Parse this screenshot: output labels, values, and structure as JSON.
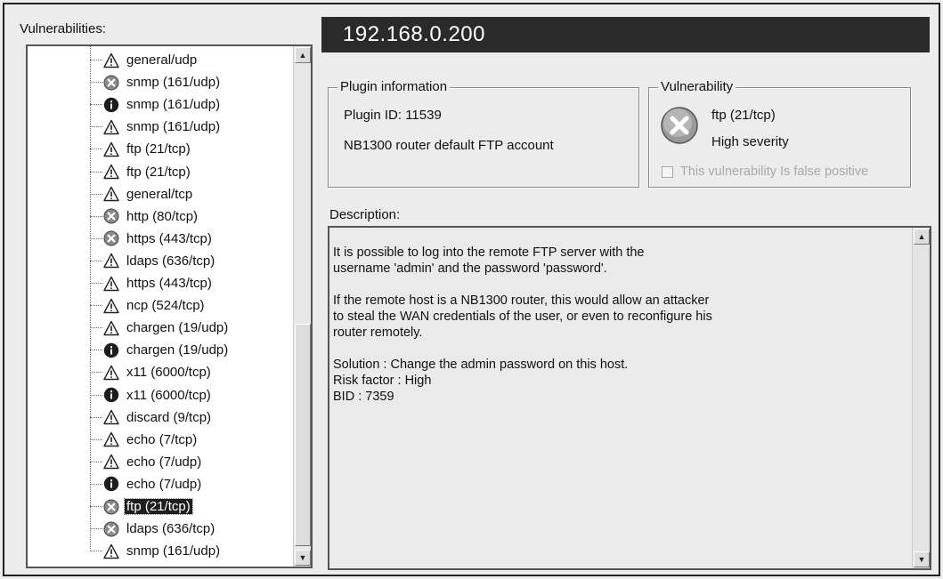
{
  "tree": {
    "label": "Vulnerabilities:",
    "items": [
      {
        "icon": "warning",
        "label": "general/udp"
      },
      {
        "icon": "high",
        "label": "snmp (161/udp)"
      },
      {
        "icon": "info",
        "label": "snmp (161/udp)"
      },
      {
        "icon": "warning",
        "label": "snmp (161/udp)"
      },
      {
        "icon": "warning",
        "label": "ftp (21/tcp)"
      },
      {
        "icon": "warning",
        "label": "ftp (21/tcp)"
      },
      {
        "icon": "warning",
        "label": "general/tcp"
      },
      {
        "icon": "high",
        "label": "http (80/tcp)"
      },
      {
        "icon": "high",
        "label": "https (443/tcp)"
      },
      {
        "icon": "warning",
        "label": "ldaps (636/tcp)"
      },
      {
        "icon": "warning",
        "label": "https (443/tcp)"
      },
      {
        "icon": "warning",
        "label": "ncp (524/tcp)"
      },
      {
        "icon": "warning",
        "label": "chargen (19/udp)"
      },
      {
        "icon": "info",
        "label": "chargen (19/udp)"
      },
      {
        "icon": "warning",
        "label": "x11 (6000/tcp)"
      },
      {
        "icon": "info",
        "label": "x11 (6000/tcp)"
      },
      {
        "icon": "warning",
        "label": "discard (9/tcp)"
      },
      {
        "icon": "warning",
        "label": "echo (7/tcp)"
      },
      {
        "icon": "warning",
        "label": "echo (7/udp)"
      },
      {
        "icon": "info",
        "label": "echo (7/udp)"
      },
      {
        "icon": "high",
        "label": "ftp (21/tcp)",
        "selected": true
      },
      {
        "icon": "high",
        "label": "ldaps (636/tcp)"
      },
      {
        "icon": "warning",
        "label": "snmp (161/udp)"
      }
    ]
  },
  "host": "192.168.0.200",
  "plugin": {
    "title": "Plugin information",
    "id_text": "Plugin ID: 11539",
    "name": "NB1300 router default FTP account"
  },
  "vulnerability": {
    "title": "Vulnerability",
    "port": "ftp (21/tcp)",
    "severity": "High severity",
    "false_positive_label": "This vulnerability Is false positive"
  },
  "description": {
    "label": "Description:",
    "paragraphs": [
      [
        "It is possible to log into the remote FTP server with the",
        "username 'admin' and the password 'password'."
      ],
      [
        "If the remote host is a NB1300 router, this would allow an attacker",
        "to steal the WAN credentials of the user, or even to reconfigure his",
        "router remotely."
      ],
      [
        "Solution : Change the admin password on this host.",
        "Risk factor : High",
        "BID : 7359"
      ]
    ]
  }
}
